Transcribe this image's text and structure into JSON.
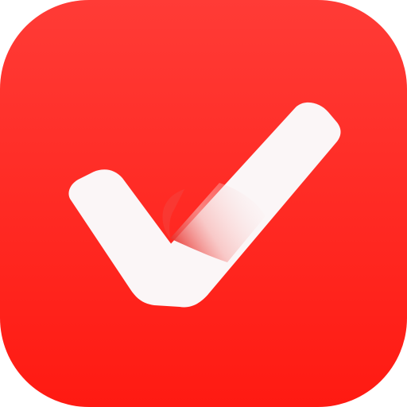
{
  "icon": {
    "name": "checkmark-icon",
    "colors": {
      "background_top": "#FF3B36",
      "background_bottom": "#FF1A12",
      "check": "#FBF6F7",
      "check_shadow": "#E9342F"
    }
  }
}
